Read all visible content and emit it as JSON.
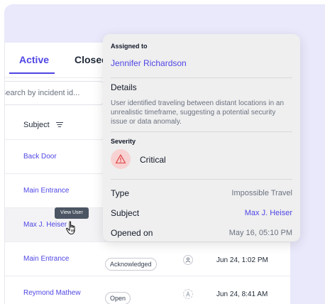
{
  "tabs": {
    "active": "Active",
    "closed": "Closed"
  },
  "search": {
    "placeholder": "Search by incident id..."
  },
  "columns": {
    "subject": "Subject"
  },
  "rows": [
    {
      "subject": "Back Door",
      "status": "",
      "date": ""
    },
    {
      "subject": "Main Entrance",
      "status": "",
      "date": ""
    },
    {
      "subject": "Max J. Heiser",
      "status": "",
      "date": ""
    },
    {
      "subject": "Main Entrance",
      "status": "Acknowledged",
      "date": "Jun 24, 1:02 PM"
    },
    {
      "subject": "Reymond Mathew",
      "status": "Open",
      "date": "Jun 24, 8:41 AM"
    }
  ],
  "tooltip": "View User",
  "popover": {
    "assigned_label": "Assigned to",
    "assignee": "Jennifer Richardson",
    "details_label": "Details",
    "details_text": "User identified traveling between distant locations in an unrealistic timeframe, suggesting a potential security issue or data anomaly.",
    "severity_label": "Severity",
    "severity_value": "Critical",
    "type_label": "Type",
    "type_value": "Impossible Travel",
    "subject_label": "Subject",
    "subject_value": "Max J. Heiser",
    "opened_label": "Opened on",
    "opened_value": "May 16, 05:10 PM"
  },
  "colors": {
    "accent": "#4f46e5",
    "critical": "#e05252",
    "critical_bg": "#f8d2d2"
  }
}
